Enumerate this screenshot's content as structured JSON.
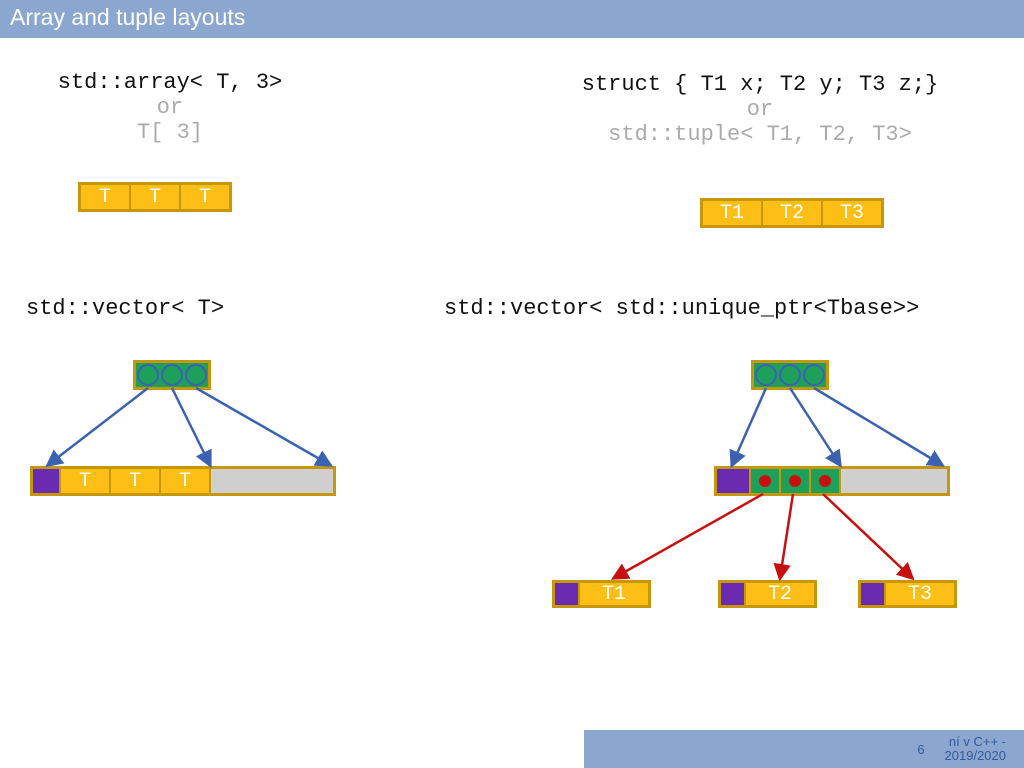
{
  "title": "Array and tuple layouts",
  "footer": {
    "page": "6",
    "course_line1": "ní v C++ -",
    "course_line2": "2019/2020"
  },
  "array_block": {
    "line1": "std::array< T, 3>",
    "or": "or",
    "line2": "T[ 3]",
    "cells": [
      "T",
      "T",
      "T"
    ]
  },
  "struct_block": {
    "line1": "struct { T1 x; T2 y; T3 z;}",
    "or": "or",
    "line2": "std::tuple< T1, T2, T3>",
    "cells": [
      "T1",
      "T2",
      "T3"
    ]
  },
  "vector_block": {
    "header": "std::vector< T>",
    "cells": [
      "T",
      "T",
      "T"
    ]
  },
  "uptr_block": {
    "header": "std::vector< std::unique_ptr<Tbase>>",
    "leaves": [
      "T1",
      "T2",
      "T3"
    ]
  }
}
